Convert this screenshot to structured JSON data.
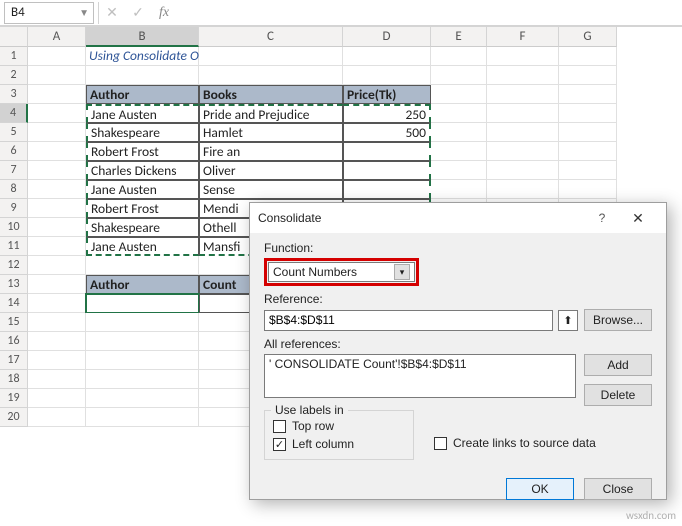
{
  "name_box": "B4",
  "formula_bar": "",
  "title": "Using Consolidate Option",
  "columns": [
    "A",
    "B",
    "C",
    "D",
    "E",
    "F",
    "G"
  ],
  "rows": [
    "1",
    "2",
    "3",
    "4",
    "5",
    "6",
    "7",
    "8",
    "9",
    "10",
    "11",
    "12",
    "13",
    "14",
    "15",
    "16",
    "17",
    "18",
    "19",
    "20"
  ],
  "table1": {
    "headers": [
      "Author",
      "Books",
      "Price(Tk)"
    ],
    "data": [
      [
        "Jane Austen",
        "Pride and Prejudice",
        "250"
      ],
      [
        "Shakespeare",
        "Hamlet",
        "500"
      ],
      [
        "Robert Frost",
        "Fire an",
        ""
      ],
      [
        "Charles Dickens",
        "Oliver",
        ""
      ],
      [
        "Jane Austen",
        "Sense",
        ""
      ],
      [
        "Robert Frost",
        "Mendi",
        ""
      ],
      [
        "Shakespeare",
        "Othell",
        ""
      ],
      [
        "Jane Austen",
        "Mansfi",
        ""
      ]
    ]
  },
  "table2": {
    "headers": [
      "Author",
      "Count"
    ]
  },
  "dialog": {
    "title": "Consolidate",
    "help": "?",
    "close": "✕",
    "function_label": "Function:",
    "function_value": "Count Numbers",
    "reference_label": "Reference:",
    "reference_value": "$B$4:$D$11",
    "all_refs_label": "All references:",
    "all_refs_item": "' CONSOLIDATE Count'!$B$4:$D$11",
    "browse": "Browse...",
    "add": "Add",
    "delete": "Delete",
    "labels_legend": "Use labels in",
    "top_row": "Top row",
    "left_column": "Left column",
    "create_links": "Create links to source data",
    "ok": "OK",
    "close_btn": "Close"
  },
  "watermark": "wsxdn.com"
}
